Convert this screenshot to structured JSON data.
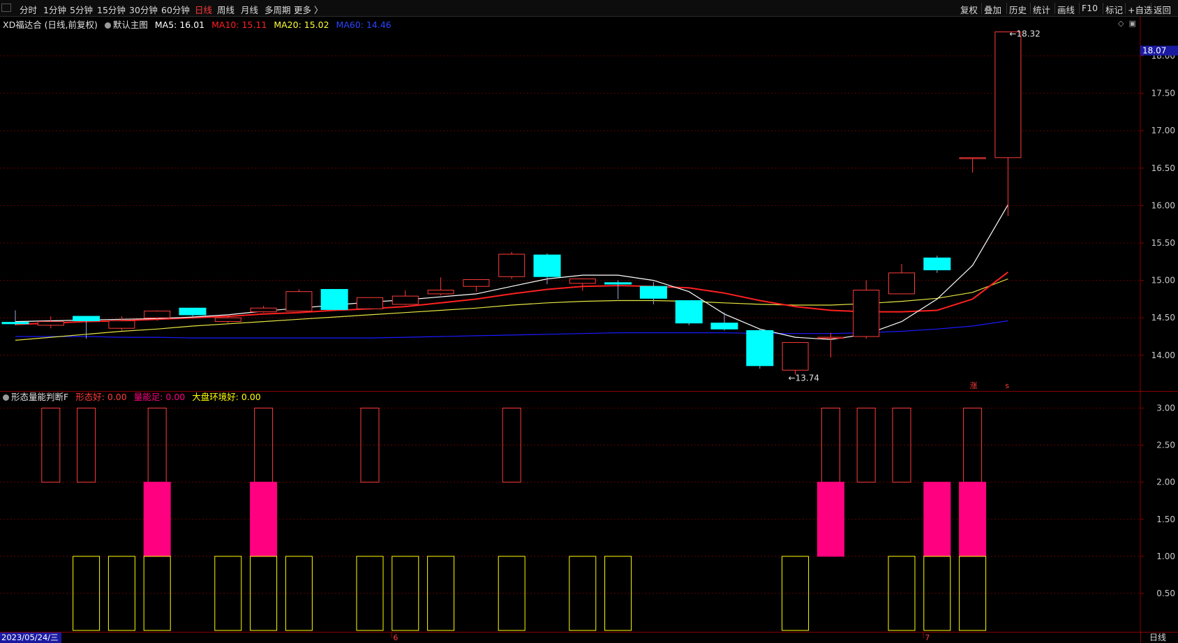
{
  "toolbar": {
    "periods": [
      {
        "label": "分时",
        "active": false
      },
      {
        "label": "1分钟",
        "active": false
      },
      {
        "label": "5分钟",
        "active": false
      },
      {
        "label": "15分钟",
        "active": false
      },
      {
        "label": "30分钟",
        "active": false
      },
      {
        "label": "60分钟",
        "active": false
      },
      {
        "label": "日线",
        "active": true
      },
      {
        "label": "周线",
        "active": false
      },
      {
        "label": "月线",
        "active": false
      },
      {
        "label": "多周期",
        "active": false
      },
      {
        "label": "更多 〉",
        "active": false
      }
    ],
    "right_buttons": [
      "复权",
      "叠加",
      "历史",
      "统计",
      "画线",
      "F10",
      "标记",
      "+自选",
      "返回"
    ]
  },
  "main_legend": {
    "title": "XD福达合 (日线,前复权)",
    "template": "默认主图",
    "ma5": "MA5: 16.01",
    "ma10": "MA10: 15.11",
    "ma20": "MA20: 15.02",
    "ma60": "MA60: 14.46"
  },
  "indicator_legend": {
    "name": "形态量能判断F",
    "f1": "形态好: 0.00",
    "f2": "量能足: 0.00",
    "f3": "大盘环境好: 0.00"
  },
  "footer": {
    "date": "2023/05/24/三",
    "period": "日线",
    "month_marks": [
      {
        "label": "6",
        "index": 11
      },
      {
        "label": "7",
        "index": 26
      }
    ]
  },
  "annotations": {
    "high_label": "18.32",
    "low_label": "13.74",
    "current_price": "18.07",
    "mark_zhang": "涨",
    "mark_s": "s"
  },
  "colors": {
    "up": "#ff3b3b",
    "down": "#00ffff",
    "ma5": "#ffffff",
    "ma10": "#ff2020",
    "ma20": "#ffff40",
    "ma60": "#2222ff",
    "grid": "#7a0000",
    "pink": "#ff0080",
    "yellow": "#ffff00"
  },
  "chart_data": [
    {
      "type": "candlestick",
      "title": "XD福达合 (日线,前复权)",
      "yaxis": {
        "min": 13.6,
        "max": 18.4,
        "ticks": [
          14.0,
          14.5,
          15.0,
          15.5,
          16.0,
          16.5,
          17.0,
          17.5,
          18.0
        ]
      },
      "candles": [
        {
          "o": 14.44,
          "h": 14.6,
          "l": 14.4,
          "c": 14.42
        },
        {
          "o": 14.4,
          "h": 14.52,
          "l": 14.36,
          "c": 14.45
        },
        {
          "o": 14.52,
          "h": 14.52,
          "l": 14.22,
          "c": 14.46
        },
        {
          "o": 14.36,
          "h": 14.52,
          "l": 14.33,
          "c": 14.46
        },
        {
          "o": 14.5,
          "h": 14.6,
          "l": 14.46,
          "c": 14.59
        },
        {
          "o": 14.63,
          "h": 14.63,
          "l": 14.52,
          "c": 14.54
        },
        {
          "o": 14.45,
          "h": 14.53,
          "l": 14.43,
          "c": 14.5
        },
        {
          "o": 14.58,
          "h": 14.66,
          "l": 14.57,
          "c": 14.63
        },
        {
          "o": 14.59,
          "h": 14.88,
          "l": 14.59,
          "c": 14.85
        },
        {
          "o": 14.88,
          "h": 14.88,
          "l": 14.6,
          "c": 14.61
        },
        {
          "o": 14.62,
          "h": 14.77,
          "l": 14.61,
          "c": 14.77
        },
        {
          "o": 14.68,
          "h": 14.87,
          "l": 14.67,
          "c": 14.79
        },
        {
          "o": 14.82,
          "h": 15.04,
          "l": 14.8,
          "c": 14.87
        },
        {
          "o": 14.92,
          "h": 15.0,
          "l": 14.85,
          "c": 15.01
        },
        {
          "o": 15.05,
          "h": 15.38,
          "l": 15.02,
          "c": 15.35
        },
        {
          "o": 15.34,
          "h": 15.36,
          "l": 14.95,
          "c": 15.05
        },
        {
          "o": 14.96,
          "h": 15.02,
          "l": 14.86,
          "c": 15.02
        },
        {
          "o": 14.97,
          "h": 15.0,
          "l": 14.75,
          "c": 14.95
        },
        {
          "o": 14.92,
          "h": 14.98,
          "l": 14.68,
          "c": 14.76
        },
        {
          "o": 14.73,
          "h": 14.73,
          "l": 14.4,
          "c": 14.43
        },
        {
          "o": 14.43,
          "h": 14.57,
          "l": 14.33,
          "c": 14.35
        },
        {
          "o": 14.33,
          "h": 14.35,
          "l": 13.82,
          "c": 13.86
        },
        {
          "o": 13.8,
          "h": 14.17,
          "l": 13.74,
          "c": 14.17
        },
        {
          "o": 14.24,
          "h": 14.3,
          "l": 13.97,
          "c": 14.24
        },
        {
          "o": 14.25,
          "h": 15.0,
          "l": 14.22,
          "c": 14.87
        },
        {
          "o": 14.82,
          "h": 15.22,
          "l": 14.82,
          "c": 15.1
        },
        {
          "o": 15.3,
          "h": 15.33,
          "l": 15.1,
          "c": 15.14
        },
        {
          "o": 16.64,
          "h": 16.64,
          "l": 16.44,
          "c": 16.64
        },
        {
          "o": 16.64,
          "h": 18.32,
          "l": 15.86,
          "c": 18.32
        }
      ],
      "ma": {
        "MA5": [
          14.44,
          14.45,
          14.46,
          14.47,
          14.48,
          14.49,
          14.51,
          14.54,
          14.59,
          14.63,
          14.67,
          14.71,
          14.74,
          14.78,
          14.82,
          14.92,
          15.02,
          15.07,
          15.07,
          15.0,
          14.85,
          14.55,
          14.35,
          14.24,
          14.21,
          14.28,
          14.45,
          14.75,
          15.2,
          16.01
        ],
        "MA10": [
          14.4,
          14.41,
          14.43,
          14.45,
          14.46,
          14.48,
          14.5,
          14.52,
          14.55,
          14.57,
          14.6,
          14.62,
          14.65,
          14.7,
          14.75,
          14.82,
          14.88,
          14.92,
          14.93,
          14.92,
          14.9,
          14.83,
          14.73,
          14.65,
          14.6,
          14.58,
          14.58,
          14.6,
          14.75,
          15.11
        ],
        "MA20": [
          14.15,
          14.2,
          14.24,
          14.28,
          14.32,
          14.35,
          14.39,
          14.42,
          14.45,
          14.48,
          14.51,
          14.54,
          14.57,
          14.6,
          14.63,
          14.67,
          14.7,
          14.72,
          14.73,
          14.73,
          14.72,
          14.7,
          14.68,
          14.67,
          14.67,
          14.69,
          14.72,
          14.76,
          14.84,
          15.02
        ],
        "MA60": [
          14.25,
          14.25,
          14.25,
          14.25,
          14.24,
          14.24,
          14.23,
          14.23,
          14.23,
          14.23,
          14.23,
          14.23,
          14.24,
          14.25,
          14.26,
          14.27,
          14.28,
          14.29,
          14.3,
          14.3,
          14.3,
          14.3,
          14.29,
          14.29,
          14.29,
          14.3,
          14.32,
          14.35,
          14.39,
          14.46
        ]
      }
    },
    {
      "type": "bar",
      "title": "形态量能判断F",
      "yaxis": {
        "min": 0,
        "max": 3.2,
        "ticks": [
          0.5,
          1.0,
          1.5,
          2.0,
          2.5,
          3.0
        ]
      },
      "series": [
        {
          "name": "形态好",
          "range": [
            2,
            3
          ],
          "indices": [
            1,
            2,
            4,
            7,
            10,
            14,
            23,
            24,
            25,
            27
          ]
        },
        {
          "name": "量能足",
          "range": [
            1,
            2
          ],
          "indices": [
            4,
            7,
            23,
            26,
            27
          ]
        },
        {
          "name": "大盘环境好",
          "range": [
            0,
            1
          ],
          "indices": [
            2,
            3,
            4,
            6,
            7,
            8,
            10,
            11,
            12,
            14,
            16,
            17,
            22,
            25,
            26,
            27
          ]
        }
      ]
    }
  ]
}
